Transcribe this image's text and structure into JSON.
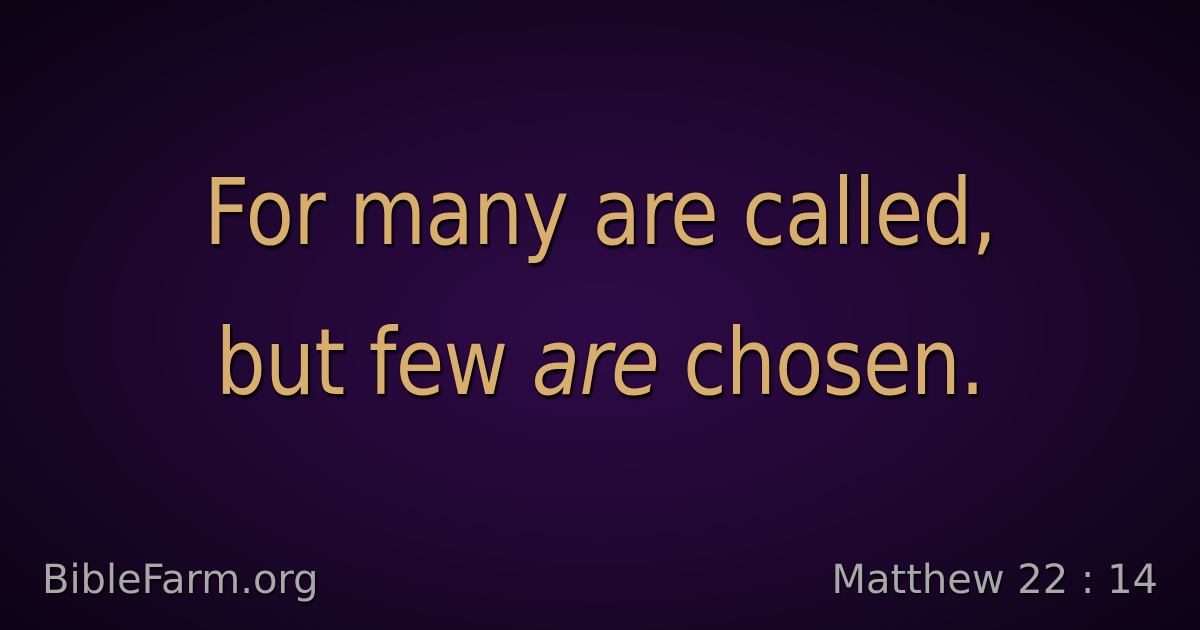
{
  "verse": {
    "line1": "For many are called,",
    "line2_before": "but few ",
    "line2_emphasis": "are",
    "line2_after": " chosen."
  },
  "footer": {
    "site": "BibleFarm.org",
    "reference": "Matthew 22 : 14"
  },
  "colors": {
    "verse_text": "#d9ad6c",
    "footer_text": "#a8a8a8",
    "background_center": "#2e0a47",
    "background_edge": "#0b0212"
  }
}
